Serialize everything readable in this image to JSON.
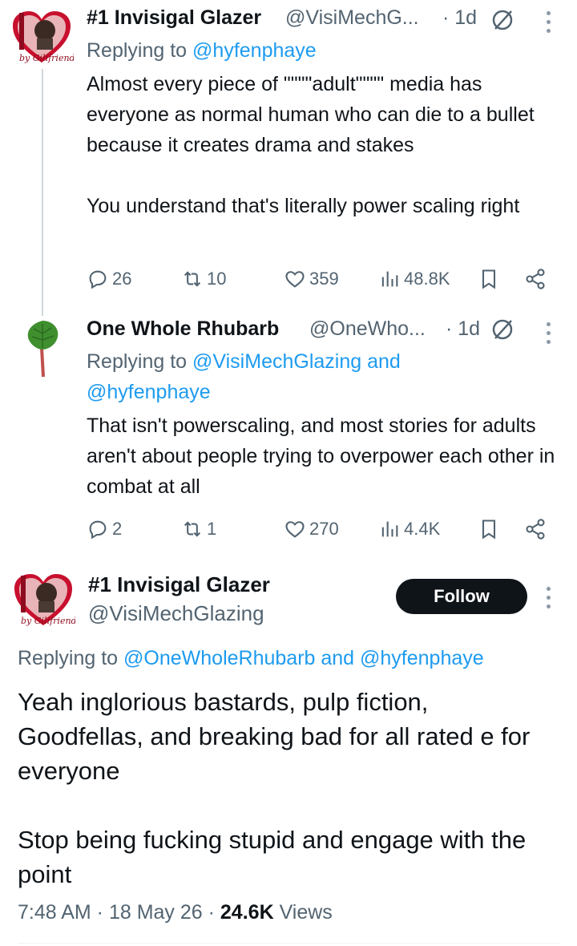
{
  "reply1": {
    "name": "#1 Invisigal Glazer",
    "handle": "@VisiMechG...",
    "time": "· 1d",
    "replying_prefix": "Replying to ",
    "replying_handles": "@hyfenphaye",
    "text": "Almost every piece of \"\"\"\"adult\"\"\"\" media has everyone as normal human who can die to a bullet because it creates drama and stakes\n\nYou understand that's literally power scaling right",
    "replies": "26",
    "reposts": "10",
    "likes": "359",
    "views": "48.8K"
  },
  "reply2": {
    "name": "One Whole Rhubarb",
    "handle": "@OneWho...",
    "time": "· 1d",
    "replying_prefix": "Replying to ",
    "replying_handles": "@VisiMechGlazing and @hyfenphaye",
    "text": "That isn't powerscaling, and most stories for adults aren't about people trying to overpower each other in combat at all",
    "replies": "2",
    "reposts": "1",
    "likes": "270",
    "views": "4.4K"
  },
  "main": {
    "name": "#1 Invisigal Glazer",
    "handle": "@VisiMechGlazing",
    "follow_label": "Follow",
    "replying_prefix": "Replying to ",
    "replying_handles": "@OneWholeRhubarb and @hyfenphaye",
    "text": "Yeah inglorious bastards, pulp fiction, Goodfellas, and breaking bad for all rated e for everyone\n\nStop being fucking stupid and engage with the point",
    "time": "7:48 AM · 18 May 26 · ",
    "views_count": "24.6K",
    "views_label": " Views"
  },
  "colors": {
    "link": "#1d9bf0",
    "muted": "#536471",
    "text": "#0f1419"
  }
}
